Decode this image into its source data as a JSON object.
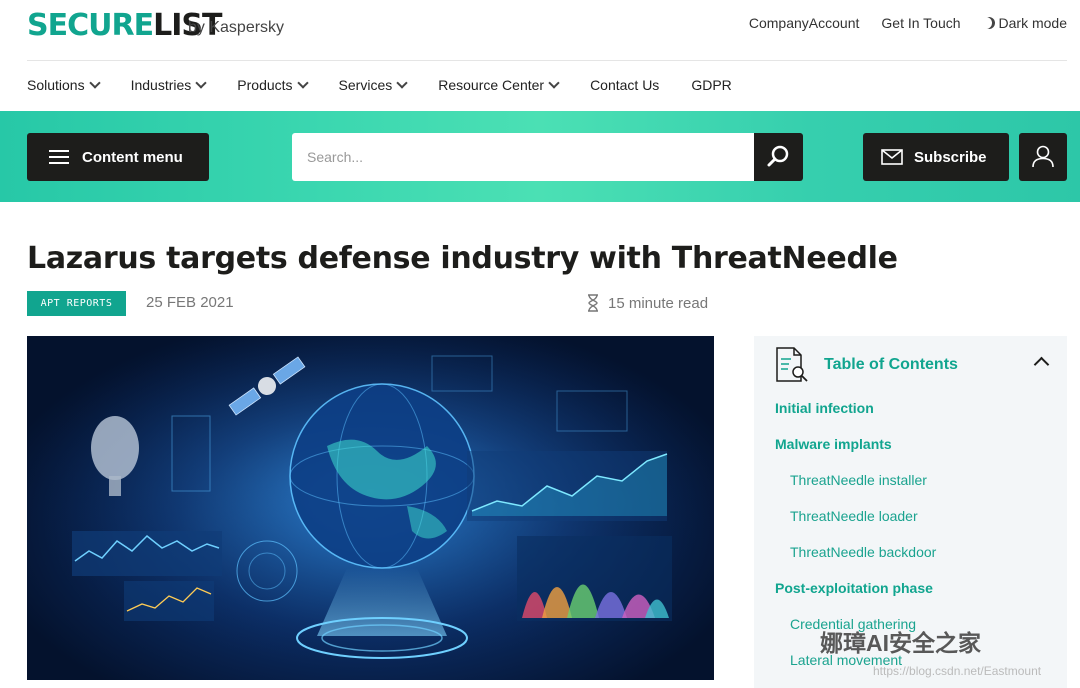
{
  "brand": {
    "logo_secure": "SECURE",
    "logo_list": "LIST",
    "byline": "by Kaspersky"
  },
  "top_links": {
    "company_account": "CompanyAccount",
    "get_in_touch": "Get In Touch",
    "dark_mode": "Dark mode"
  },
  "nav": [
    {
      "label": "Solutions",
      "dropdown": true
    },
    {
      "label": "Industries",
      "dropdown": true
    },
    {
      "label": "Products",
      "dropdown": true
    },
    {
      "label": "Services",
      "dropdown": true
    },
    {
      "label": "Resource Center",
      "dropdown": true
    },
    {
      "label": "Contact Us",
      "dropdown": false
    },
    {
      "label": "GDPR",
      "dropdown": false
    }
  ],
  "toolbar": {
    "content_menu": "Content menu",
    "search_placeholder": "Search...",
    "subscribe": "Subscribe"
  },
  "article": {
    "title": "Lazarus targets defense industry with ThreatNeedle",
    "category": "APT REPORTS",
    "date": "25 FEB 2021",
    "read_time": "15 minute read"
  },
  "toc": {
    "title": "Table of Contents",
    "items": [
      {
        "label": "Initial infection",
        "level": 1
      },
      {
        "label": "Malware implants",
        "level": 1
      },
      {
        "label": "ThreatNeedle installer",
        "level": 2
      },
      {
        "label": "ThreatNeedle loader",
        "level": 2
      },
      {
        "label": "ThreatNeedle backdoor",
        "level": 2
      },
      {
        "label": "Post-exploitation phase",
        "level": 1
      },
      {
        "label": "Credential gathering",
        "level": 2
      },
      {
        "label": "Lateral movement",
        "level": 2
      }
    ]
  },
  "watermark": {
    "text": "娜璋AI安全之家",
    "url": "https://blog.csdn.net/Eastmount"
  },
  "colors": {
    "accent": "#11a58f",
    "dark": "#1d1d1b",
    "band": "#3bd7b0"
  }
}
